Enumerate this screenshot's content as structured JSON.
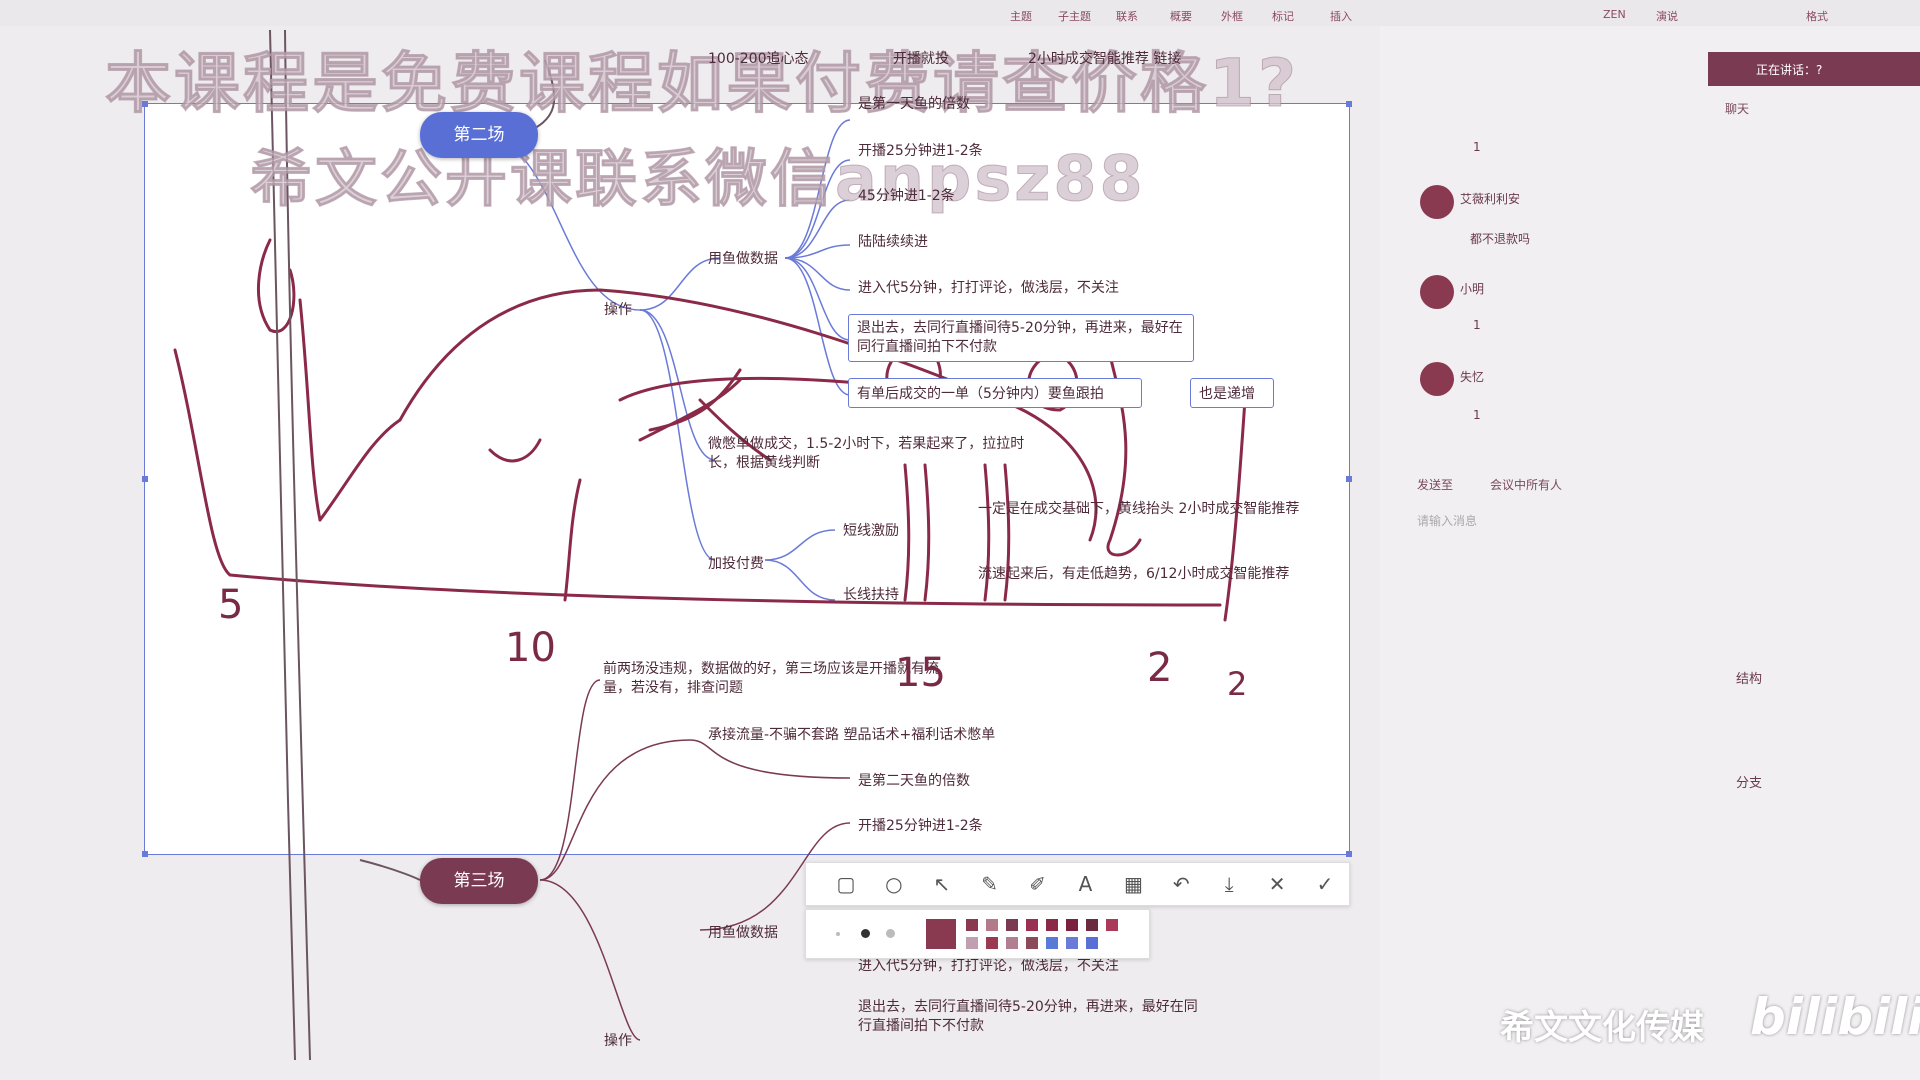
{
  "topbar": {
    "tools": [
      "主题",
      "子主题",
      "联系",
      "概要",
      "外框",
      "标记",
      "插入",
      "ZEN",
      "演说",
      "格式"
    ]
  },
  "watermark": {
    "line1": "本课程是免费课程如果付费请查价格1?",
    "line2": "希文公开课联系微信anpsz88"
  },
  "mindmap": {
    "session2": "第二场",
    "session3": "第三场",
    "top_nodes": [
      "100-200追心态",
      "开播就投",
      "2小时成交智能推荐 链接"
    ],
    "multiplier": "是第一天鱼的倍数",
    "start25": "开播25分钟进1-2条",
    "min45": "45分钟进1-2条",
    "gradual": "陆陆续续进",
    "fish_data": "用鱼做数据",
    "enter5": "进入代5分钟，打打评论，做浅层，不关注",
    "exit": "退出去，去同行直播间待5-20分钟，再进来，最好在同行直播间拍下不付款",
    "bought": "有单后成交的一单（5分钟内）要鱼跟拍",
    "also_inc": "也是递增",
    "operation": "操作",
    "micro_deal": "微憋单做成交，1.5-2小时下，若果起来了，拉拉时长，根据黄线判断",
    "add_pay": "加投付费",
    "short_line": "短线激励",
    "long_line": "长线扶持",
    "short_desc": "一定是在成交基础下，黄线抬头 2小时成交智能推荐",
    "long_desc": "流速起来后，有走低趋势，6/12小时成交智能推荐",
    "prev_two": "前两场没违规，数据做的好，第三场应该是开播就有流量，若没有，排查问题",
    "take_flow": "承接流量-不骗不套路 塑品话术+福利话术憋单",
    "multiplier2": "是第二天鱼的倍数",
    "start25_2": "开播25分钟进1-2条",
    "fish_data2": "用鱼做数据",
    "enter5_2": "进入代5分钟，打打评论，做浅层，不关注",
    "exit2": "退出去，去同行直播间待5-20分钟，再进来，最好在同行直播间拍下不付款",
    "operation2": "操作"
  },
  "handwriting": {
    "n5": "5",
    "n10": "10",
    "n15": "15",
    "n2": "2",
    "n2b": "2"
  },
  "chat": {
    "header": "正在讲话：?",
    "tab": "聊天",
    "entries": [
      {
        "name": "",
        "msg": "1"
      },
      {
        "name": "艾薇利利安",
        "msg": "都不退款吗"
      },
      {
        "name": "小明",
        "msg": "1"
      },
      {
        "name": "失忆",
        "msg": "1"
      }
    ],
    "send_to_label": "发送至",
    "send_to_value": "会议中所有人",
    "input_placeholder": "请输入消息"
  },
  "format_panel": {
    "structure": "结构",
    "branch": "分支"
  },
  "brand": {
    "text": "希文文化传媒",
    "logo": "bilibili"
  },
  "palette_colors": [
    "#8a3a50",
    "#b47a8a",
    "#7a3a52",
    "#9a3050",
    "#8a2a48",
    "#7a2040",
    "#6a2a40",
    "#aa3a5a",
    "#c0a0b0",
    "#9a3a50",
    "#b08090",
    "#8a4a5a",
    "#5a7ad8",
    "#6a7ad8",
    "#5a6fd6"
  ]
}
